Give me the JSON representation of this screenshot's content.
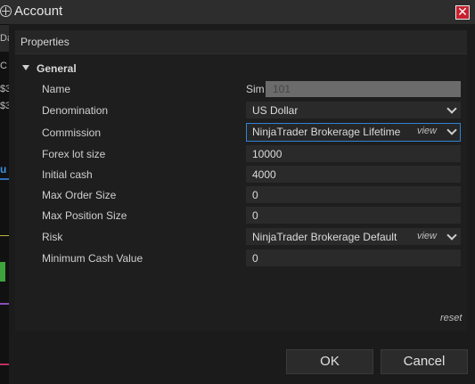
{
  "background": {
    "tab_fragment": "Da",
    "fragments": [
      "C",
      "$3",
      "$3"
    ],
    "link_fragment": "u"
  },
  "dialog": {
    "title": "Account",
    "close_glyph": "✕",
    "section_header": "Properties",
    "group": "General",
    "fields": {
      "name": {
        "label": "Name",
        "prefix": "Sim",
        "value": "101"
      },
      "denomination": {
        "label": "Denomination",
        "value": "US Dollar"
      },
      "commission": {
        "label": "Commission",
        "value": "NinjaTrader Brokerage Lifetime",
        "link": "view"
      },
      "forex_lot_size": {
        "label": "Forex lot size",
        "value": "10000"
      },
      "initial_cash": {
        "label": "Initial cash",
        "value": "4000"
      },
      "max_order_size": {
        "label": "Max Order Size",
        "value": "0"
      },
      "max_position_size": {
        "label": "Max Position Size",
        "value": "0"
      },
      "risk": {
        "label": "Risk",
        "value": "NinjaTrader Brokerage Default",
        "link": "view"
      },
      "minimum_cash_value": {
        "label": "Minimum Cash Value",
        "value": "0"
      }
    },
    "reset_label": "reset",
    "ok_label": "OK",
    "cancel_label": "Cancel"
  },
  "colors": {
    "accent": "#2f83d6",
    "close_button": "#c8202e"
  }
}
